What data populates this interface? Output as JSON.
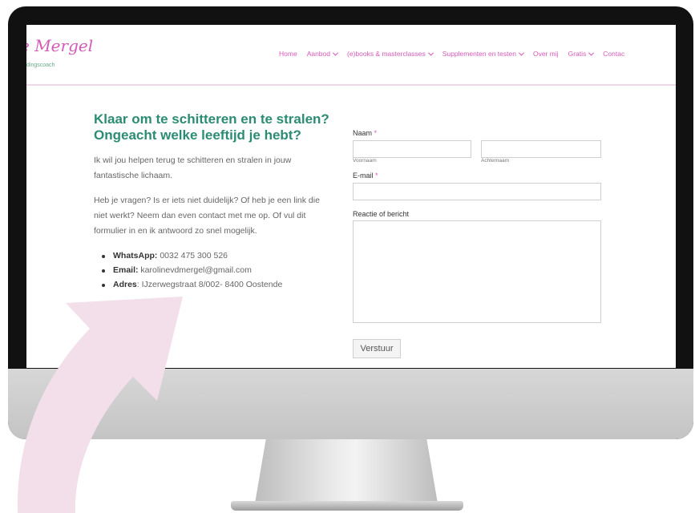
{
  "logo": {
    "text": "e Mergel",
    "subtitle": "dingscoach"
  },
  "nav": {
    "items": [
      {
        "label": "Home",
        "dropdown": false
      },
      {
        "label": "Aanbod",
        "dropdown": true
      },
      {
        "label": "(e)books & masterclasses",
        "dropdown": true
      },
      {
        "label": "Supplementen en testen",
        "dropdown": true
      },
      {
        "label": "Over mij",
        "dropdown": false
      },
      {
        "label": "Gratis",
        "dropdown": true
      },
      {
        "label": "Contac",
        "dropdown": false
      }
    ]
  },
  "content": {
    "heading_line1": "Klaar om te schitteren en te stralen?",
    "heading_line2": "Ongeacht welke leeftijd je hebt?",
    "para1": "Ik wil jou helpen terug te schitteren en stralen in jouw fantastische lichaam.",
    "para2": "Heb je vragen? Is er iets niet duidelijk? Of heb je een link die niet werkt? Neem dan even contact met me op. Of vul dit formulier in en ik antwoord zo snel mogelijk.",
    "contacts": [
      {
        "label": "WhatsApp:",
        "value": " 0032 475 300 526"
      },
      {
        "label": "Email:",
        "value": " karolinevdmergel@gmail.com"
      },
      {
        "label": "Adres",
        "value": ": IJzerwegstraat 8/002- 8400 Oostende"
      }
    ]
  },
  "form": {
    "name_label": "Naam",
    "required_mark": "*",
    "first_name_sublabel": "Voornaam",
    "last_name_sublabel": "Achternaam",
    "first_name_value": "",
    "last_name_value": "",
    "email_label": "E-mail",
    "email_value": "",
    "message_label": "Reactie of bericht",
    "message_value": "",
    "submit_label": "Verstuur"
  },
  "colors": {
    "accent_pink": "#d45ab8",
    "heading_green": "#2c8c73",
    "arrow_pink": "#f2dfe9"
  }
}
